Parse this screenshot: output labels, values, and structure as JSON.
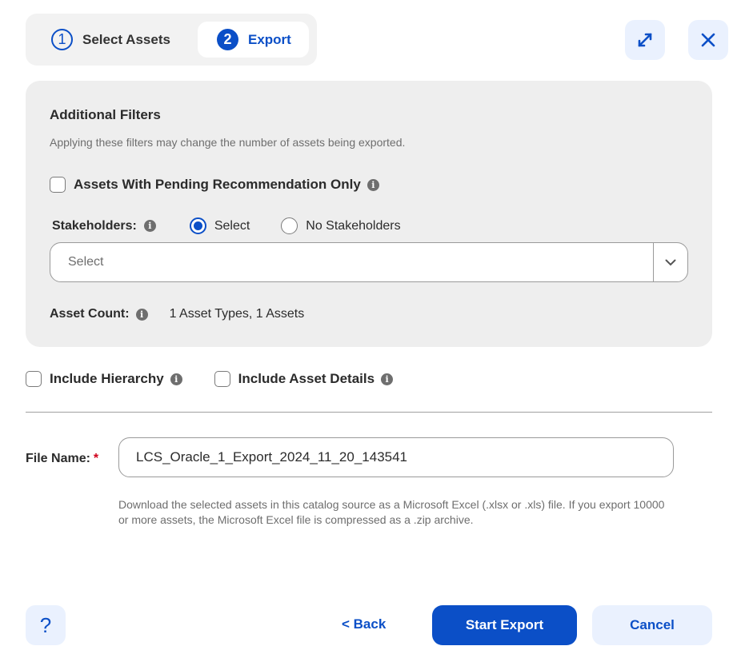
{
  "stepper": {
    "steps": [
      {
        "number": "1",
        "label": "Select Assets",
        "active": false
      },
      {
        "number": "2",
        "label": "Export",
        "active": true
      }
    ]
  },
  "header_icons": {
    "expand": "expand-icon",
    "close": "close-icon"
  },
  "filters": {
    "title": "Additional Filters",
    "subtitle": "Applying these filters may change the number of assets being exported.",
    "pending_only": {
      "label": "Assets With Pending Recommendation Only",
      "checked": false
    },
    "stakeholders": {
      "label": "Stakeholders:",
      "options": [
        {
          "label": "Select",
          "selected": true
        },
        {
          "label": "No Stakeholders",
          "selected": false
        }
      ],
      "select_placeholder": "Select"
    },
    "asset_count": {
      "label": "Asset Count:",
      "value": "1 Asset Types, 1 Assets"
    }
  },
  "include": [
    {
      "label": "Include Hierarchy",
      "checked": false
    },
    {
      "label": "Include Asset Details",
      "checked": false
    }
  ],
  "file_name": {
    "label": "File Name:",
    "required_mark": "*",
    "value": "LCS_Oracle_1_Export_2024_11_20_143541",
    "help": "Download the selected assets in this catalog source as a Microsoft Excel (.xlsx or .xls) file. If you export 10000 or more assets, the Microsoft Excel file is compressed as a .zip archive."
  },
  "footer": {
    "help_label": "?",
    "back_label": "< Back",
    "start_label": "Start Export",
    "cancel_label": "Cancel"
  },
  "colors": {
    "accent": "#0b4fc7",
    "accent_light": "#eaf1fe",
    "panel_bg": "#eeeeee",
    "required": "#d0021b"
  }
}
